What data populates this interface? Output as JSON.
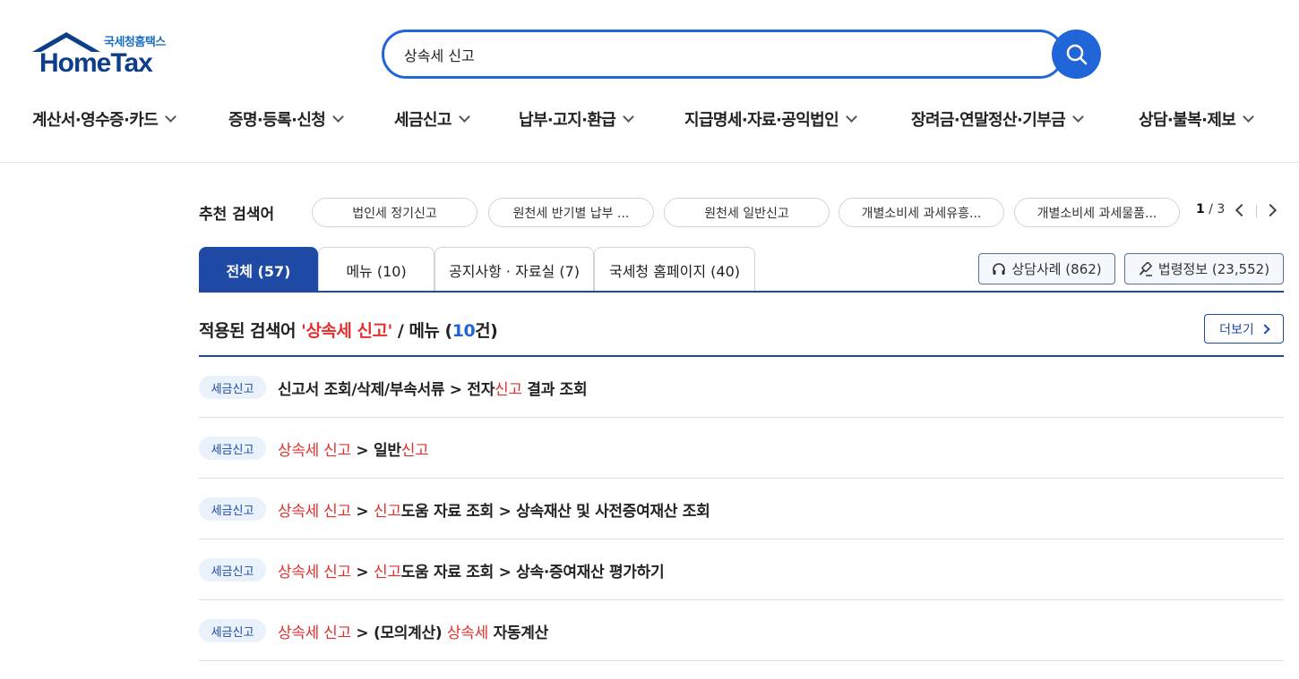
{
  "logo": {
    "ko": "국세청홈택스",
    "en": "HomeTax"
  },
  "search": {
    "value": "상속세 신고"
  },
  "gnb": [
    "계산서·영수증·카드",
    "증명·등록·신청",
    "세금신고",
    "납부·고지·환급",
    "지급명세·자료·공익법인",
    "장려금·연말정산·기부금",
    "상담·불복·제보"
  ],
  "recommend": {
    "label": "추천 검색어",
    "chips": [
      "법인세 정기신고",
      "원천세 반기별 납부 ...",
      "원천세 일반신고",
      "개별소비세 과세유흥...",
      "개별소비세 과세물품..."
    ],
    "page_current": "1",
    "page_total": " / 3"
  },
  "tabs": [
    "전체 (57)",
    "메뉴 (10)",
    "공지사항 · 자료실 (7)",
    "국세청 홈페이지 (40)"
  ],
  "side_buttons": {
    "consult": "상담사례 (862)",
    "law": "법령정보 (23,552)"
  },
  "section": {
    "prefix": "적용된 검색어 ",
    "keyword": "'상속세 신고'",
    "middle": " / 메뉴 (",
    "count": "10",
    "suffix": "건)",
    "more": "더보기"
  },
  "results": [
    {
      "badge": "세금신고",
      "parts": [
        {
          "t": "신고서 조회/삭제/부속서류 > 전자",
          "hl": false
        },
        {
          "t": "신고",
          "hl": true
        },
        {
          "t": " 결과 조회",
          "hl": false
        }
      ]
    },
    {
      "badge": "세금신고",
      "parts": [
        {
          "t": "상속세 신고",
          "hl": true
        },
        {
          "t": " > 일반",
          "hl": false
        },
        {
          "t": "신고",
          "hl": true
        }
      ]
    },
    {
      "badge": "세금신고",
      "parts": [
        {
          "t": "상속세 신고",
          "hl": true
        },
        {
          "t": " > ",
          "hl": false
        },
        {
          "t": "신고",
          "hl": true
        },
        {
          "t": "도움 자료 조회 > 상속재산 및 사전증여재산 조회",
          "hl": false
        }
      ]
    },
    {
      "badge": "세금신고",
      "parts": [
        {
          "t": "상속세 신고",
          "hl": true
        },
        {
          "t": " > ",
          "hl": false
        },
        {
          "t": "신고",
          "hl": true
        },
        {
          "t": "도움 자료 조회 > 상속·증여재산 평가하기",
          "hl": false
        }
      ]
    },
    {
      "badge": "세금신고",
      "parts": [
        {
          "t": "상속세 신고",
          "hl": true
        },
        {
          "t": " > (모의계산) ",
          "hl": false
        },
        {
          "t": "상속세",
          "hl": true
        },
        {
          "t": " 자동계산",
          "hl": false
        }
      ]
    }
  ],
  "colors": {
    "primary": "#1e4aa5",
    "search_blue": "#2166d9",
    "highlight_red": "#e0312f"
  }
}
